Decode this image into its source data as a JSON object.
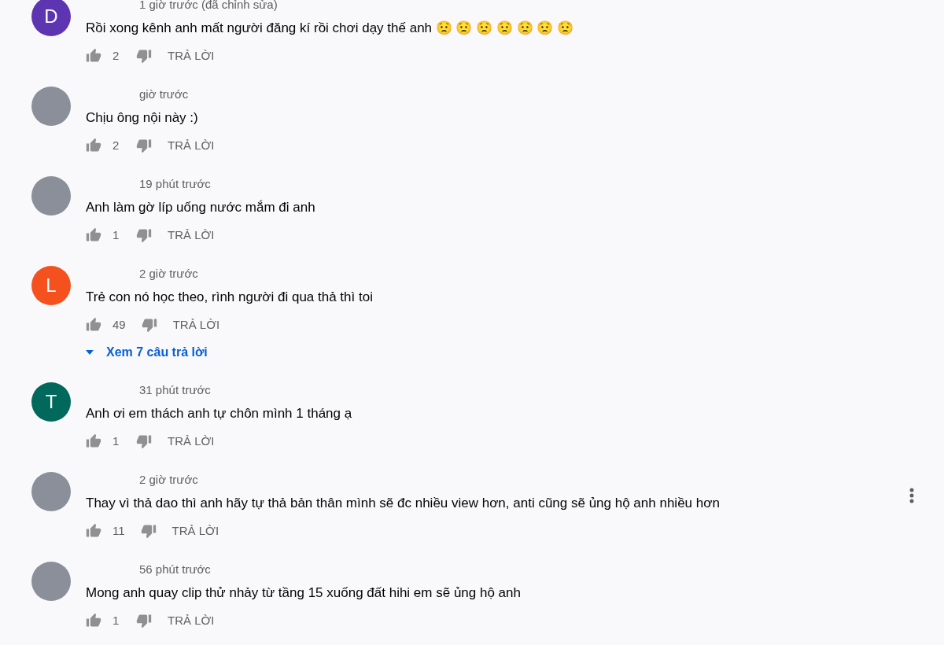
{
  "comments": [
    {
      "avatar": {
        "kind": "letter",
        "letter": "D",
        "color": "#5e35b1"
      },
      "time": "1 giờ trước (đã chỉnh sửa)",
      "text": "Rồi xong kênh anh mất người đăng kí rồi chơi dạy thế anh 😟 😟 😟 😟 😟 😟 😟",
      "likes": "2",
      "reply": "TRẢ LỜI",
      "menu_visible": false
    },
    {
      "avatar": {
        "kind": "photo"
      },
      "time": "giờ trước",
      "text": "Chịu ông nội này :)",
      "likes": "2",
      "reply": "TRẢ LỜI",
      "menu_visible": false
    },
    {
      "avatar": {
        "kind": "photo"
      },
      "time": "19 phút trước",
      "text": "Anh làm gờ líp uống nước mắm đi anh",
      "likes": "1",
      "reply": "TRẢ LỜI",
      "menu_visible": false
    },
    {
      "avatar": {
        "kind": "letter",
        "letter": "L",
        "color": "#f4511e"
      },
      "time": "2 giờ trước",
      "text": "Trẻ con nó học theo, rình người đi qua thả thì toi",
      "likes": "49",
      "reply": "TRẢ LỜI",
      "replies_link": "Xem 7 câu trả lời",
      "menu_visible": false
    },
    {
      "avatar": {
        "kind": "letter",
        "letter": "T",
        "color": "#00695c"
      },
      "time": "31 phút trước",
      "text": "Anh ơi em thách anh tự chôn mình 1 tháng ạ",
      "likes": "1",
      "reply": "TRẢ LỜI",
      "menu_visible": false
    },
    {
      "avatar": {
        "kind": "photo"
      },
      "time": "2 giờ trước",
      "text": "Thay vì thả dao thì anh hãy tự thả bản thân mình sẽ đc nhiều view hơn, anti cũng sẽ ủng hộ anh nhiều hơn",
      "likes": "11",
      "reply": "TRẢ LỜI",
      "menu_visible": true
    },
    {
      "avatar": {
        "kind": "photo"
      },
      "time": "56 phút trước",
      "text": "Mong anh quay clip thử nhảy từ tầng 15 xuống đất hihi em sẽ ủng hộ anh",
      "likes": "1",
      "reply": "TRẢ LỜI",
      "menu_visible": false
    }
  ]
}
